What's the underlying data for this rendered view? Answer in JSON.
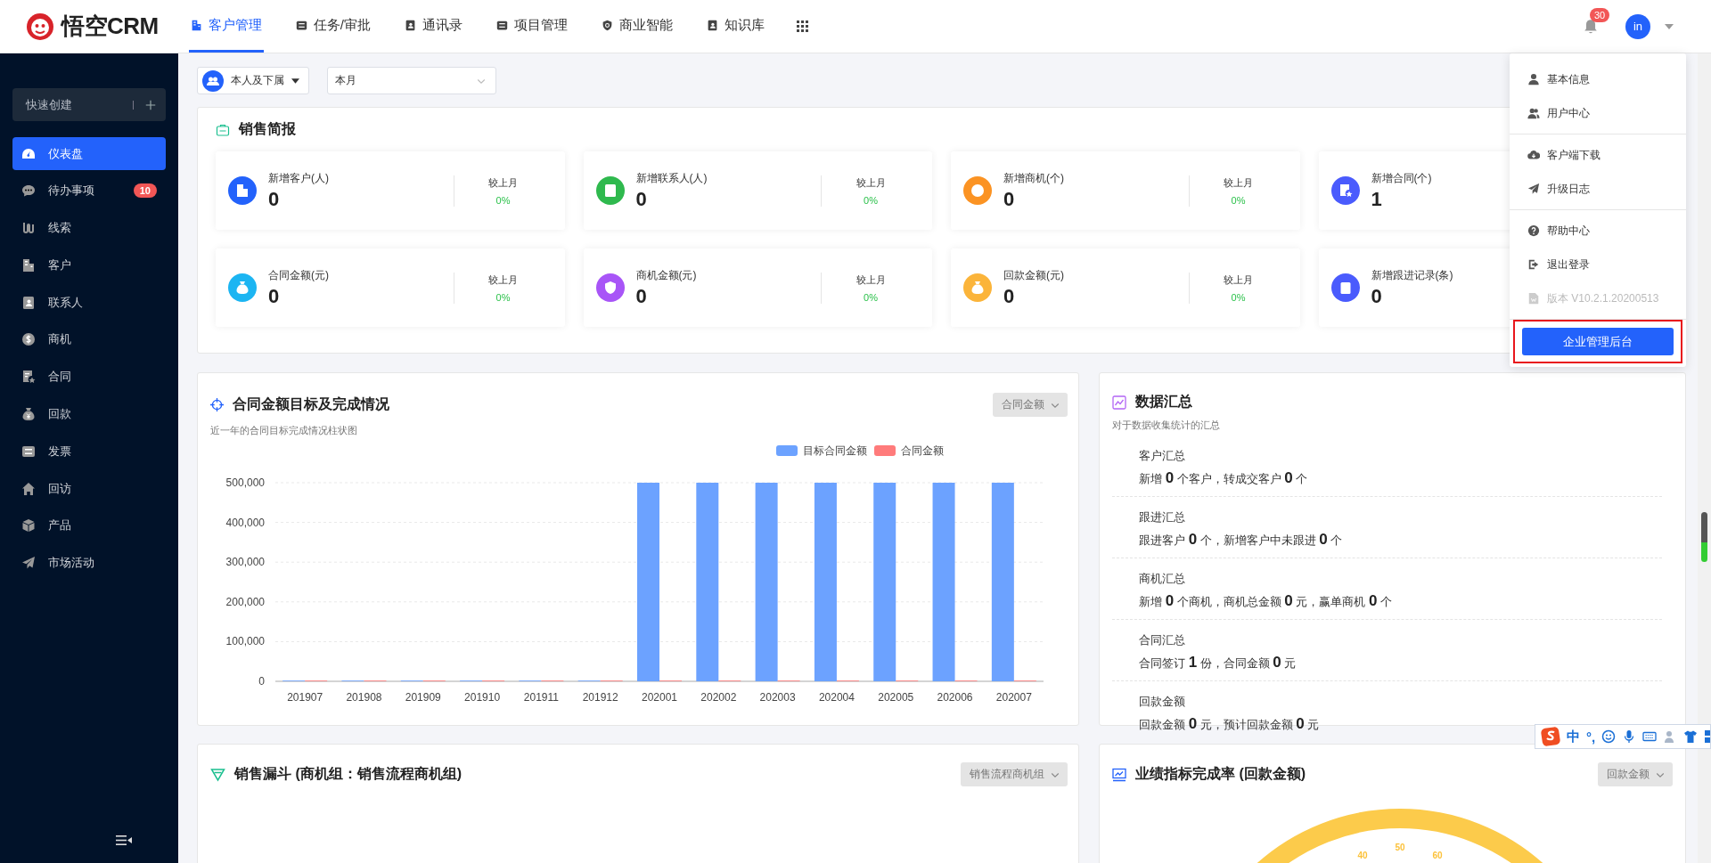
{
  "header": {
    "logo": "悟空CRM",
    "nav": [
      {
        "label": "客户管理",
        "selected": true
      },
      {
        "label": "任务/审批",
        "selected": false
      },
      {
        "label": "通讯录",
        "selected": false
      },
      {
        "label": "项目管理",
        "selected": false
      },
      {
        "label": "商业智能",
        "selected": false
      },
      {
        "label": "知识库",
        "selected": false
      }
    ],
    "notifications": "30",
    "avatar": "in"
  },
  "sidebar": {
    "quick_create": "快速创建",
    "items": [
      {
        "label": "仪表盘",
        "selected": true
      },
      {
        "label": "待办事项",
        "selected": false,
        "badge": "10"
      },
      {
        "label": "线索",
        "selected": false
      },
      {
        "label": "客户",
        "selected": false
      },
      {
        "label": "联系人",
        "selected": false
      },
      {
        "label": "商机",
        "selected": false
      },
      {
        "label": "合同",
        "selected": false
      },
      {
        "label": "回款",
        "selected": false
      },
      {
        "label": "发票",
        "selected": false
      },
      {
        "label": "回访",
        "selected": false
      },
      {
        "label": "产品",
        "selected": false
      },
      {
        "label": "市场活动",
        "selected": false
      }
    ]
  },
  "filters": {
    "scope": "本人及下属",
    "period": "本月"
  },
  "sales_brief": {
    "title": "销售简报",
    "cards": [
      {
        "label": "新增客户(人)",
        "value": "0",
        "compare_label": "较上月",
        "change": "0%",
        "color": "#2362fb"
      },
      {
        "label": "新增联系人(人)",
        "value": "0",
        "compare_label": "较上月",
        "change": "0%",
        "color": "#2fb94e"
      },
      {
        "label": "新增商机(个)",
        "value": "0",
        "compare_label": "较上月",
        "change": "0%",
        "color": "#fb9323"
      },
      {
        "label": "新增合同(个)",
        "value": "1",
        "color": "#4a5bfd"
      },
      {
        "label": "合同金额(元)",
        "value": "0",
        "compare_label": "较上月",
        "change": "0%",
        "color": "#1cb5f2"
      },
      {
        "label": "商机金额(元)",
        "value": "0",
        "compare_label": "较上月",
        "change": "0%",
        "color": "#a855f7"
      },
      {
        "label": "回款金额(元)",
        "value": "0",
        "compare_label": "较上月",
        "change": "0%",
        "color": "#fbb43a"
      },
      {
        "label": "新增跟进记录(条)",
        "value": "0",
        "color": "#4a5bfd"
      }
    ]
  },
  "contract_chart": {
    "title": "合同金额目标及完成情况",
    "subtitle": "近一年的合同目标完成情况柱状图",
    "dropdown": "合同金额",
    "chart_data": {
      "type": "bar",
      "categories": [
        "201907",
        "201908",
        "201909",
        "201910",
        "201911",
        "201912",
        "202001",
        "202002",
        "202003",
        "202004",
        "202005",
        "202006",
        "202007"
      ],
      "series": [
        {
          "name": "目标合同金额",
          "color": "#6ca2ff",
          "values": [
            0,
            0,
            0,
            0,
            0,
            0,
            500000,
            500000,
            500000,
            500000,
            500000,
            500000,
            500000
          ]
        },
        {
          "name": "合同金额",
          "color": "#ff7b7b",
          "values": [
            0,
            0,
            0,
            0,
            0,
            0,
            0,
            0,
            0,
            0,
            0,
            0,
            0
          ]
        }
      ],
      "ylim": [
        0,
        500000
      ],
      "grid": true,
      "legend": true,
      "yticks": [
        {
          "value": 0,
          "label": "0"
        },
        {
          "value": 100000,
          "label": "100,000"
        },
        {
          "value": 200000,
          "label": "200,000"
        },
        {
          "value": 300000,
          "label": "300,000"
        },
        {
          "value": 400000,
          "label": "400,000"
        },
        {
          "value": 500000,
          "label": "500,000"
        }
      ]
    }
  },
  "data_summary": {
    "title": "数据汇总",
    "subtitle": "对于数据收集统计的汇总",
    "sections": [
      {
        "title": "客户汇总",
        "text": "新增 **0** 个客户，转成交客户 **0** 个"
      },
      {
        "title": "跟进汇总",
        "text": "跟进客户 **0** 个，新增客户中未跟进 **0** 个"
      },
      {
        "title": "商机汇总",
        "text": "新增 **0** 个商机，商机总金额 **0** 元，赢单商机 **0** 个"
      },
      {
        "title": "合同汇总",
        "text": "合同签订 **1** 份，合同金额 **0** 元"
      },
      {
        "title": "回款金额",
        "text": "回款金额 **0** 元，预计回款金额 **0** 元"
      }
    ]
  },
  "funnel": {
    "title": "销售漏斗 (商机组：销售流程商机组)",
    "dropdown": "销售流程商机组"
  },
  "performance": {
    "title": "业绩指标完成率 (回款金额)",
    "dropdown": "回款金额",
    "gauge_ticks": [
      "40",
      "50",
      "60"
    ]
  },
  "user_menu": {
    "groups": [
      {
        "items": [
          {
            "label": "基本信息",
            "disabled": false
          },
          {
            "label": "用户中心",
            "disabled": false
          }
        ]
      },
      {
        "items": [
          {
            "label": "客户端下载",
            "disabled": false
          },
          {
            "label": "升级日志",
            "disabled": false
          }
        ]
      },
      {
        "items": [
          {
            "label": "帮助中心",
            "disabled": false
          },
          {
            "label": "退出登录",
            "disabled": false
          },
          {
            "label": "版本 V10.2.1.20200513",
            "disabled": true
          }
        ]
      }
    ],
    "admin_button": {
      "label": "企业管理后台",
      "highlighted": true
    }
  },
  "ime_toolbar": {
    "items": [
      "中",
      "°,"
    ]
  }
}
